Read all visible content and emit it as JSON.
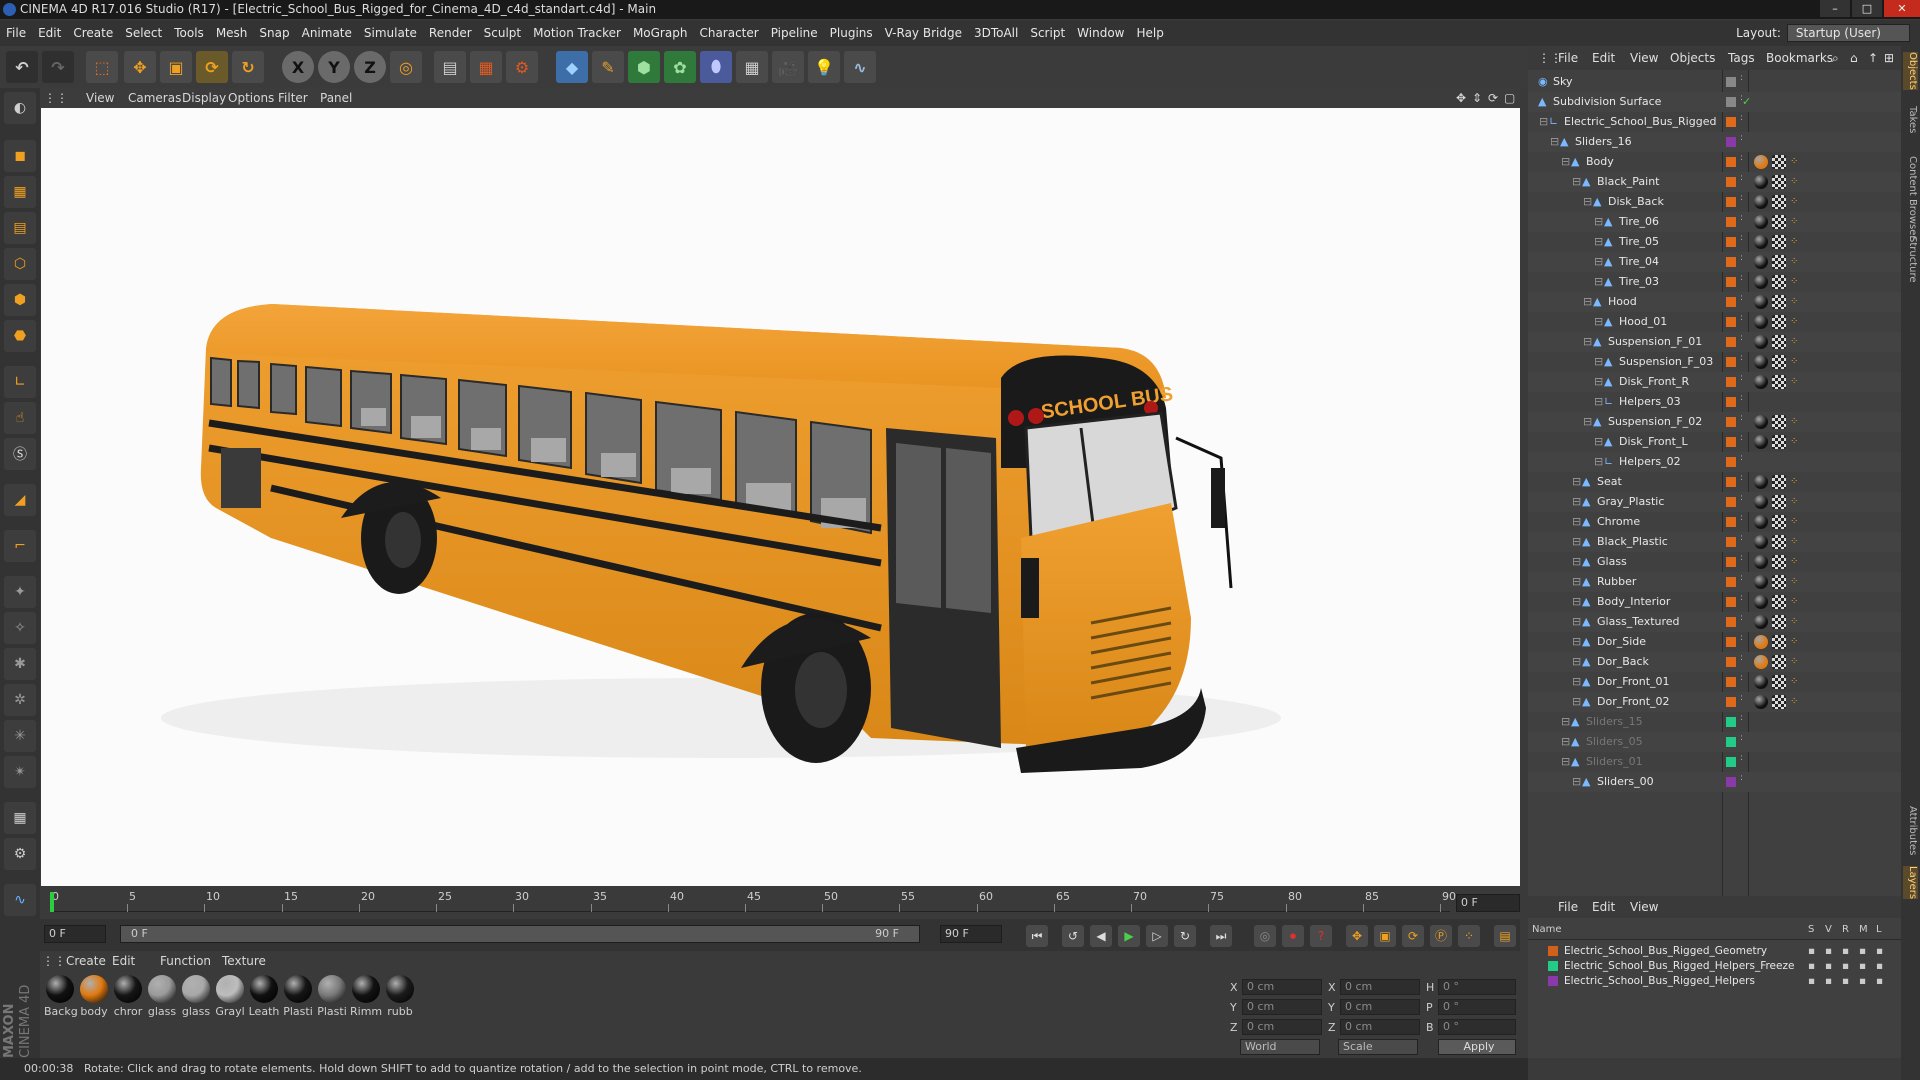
{
  "window": {
    "title": "CINEMA 4D R17.016 Studio (R17) - [Electric_School_Bus_Rigged_for_Cinema_4D_c4d_standart.c4d] - Main"
  },
  "menu": [
    "File",
    "Edit",
    "Create",
    "Select",
    "Tools",
    "Mesh",
    "Snap",
    "Animate",
    "Simulate",
    "Render",
    "Sculpt",
    "Motion Tracker",
    "MoGraph",
    "Character",
    "Pipeline",
    "Plugins",
    "V-Ray Bridge",
    "3DToAll",
    "Script",
    "Window",
    "Help"
  ],
  "layout": {
    "label": "Layout:",
    "value": "Startup (User)"
  },
  "toolbar": {
    "axis_x": "X",
    "axis_y": "Y",
    "axis_z": "Z"
  },
  "viewport_menu": [
    "View",
    "Cameras",
    "Display",
    "Options",
    "Filter",
    "Panel"
  ],
  "bus": {
    "sign": "SCHOOL BUS"
  },
  "timeline": {
    "ticks": [
      "0",
      "5",
      "10",
      "15",
      "20",
      "25",
      "30",
      "35",
      "40",
      "45",
      "50",
      "55",
      "60",
      "65",
      "70",
      "75",
      "80",
      "85",
      "90"
    ],
    "current_frame": "0 F",
    "start_field": "0 F",
    "range_start": "0 F",
    "range_end": "90 F",
    "end_field": "90 F"
  },
  "materials_menu": [
    "Create",
    "Edit",
    "Function",
    "Texture"
  ],
  "materials": [
    {
      "label": "Backg",
      "color": "#111111"
    },
    {
      "label": "body",
      "color": "#e07a10"
    },
    {
      "label": "chror",
      "color": "#151515"
    },
    {
      "label": "glass",
      "color": "#9a9a9a"
    },
    {
      "label": "glass",
      "color": "#a8a8a8"
    },
    {
      "label": "Grayl",
      "color": "#bdbdbd"
    },
    {
      "label": "Leath",
      "color": "#101010"
    },
    {
      "label": "Plasti",
      "color": "#151515"
    },
    {
      "label": "Plasti",
      "color": "#7a7a7a"
    },
    {
      "label": "Rimm",
      "color": "#121212"
    },
    {
      "label": "rubb",
      "color": "#1b1b1b"
    }
  ],
  "coords": {
    "x": "X",
    "y": "Y",
    "z": "Z",
    "pos_x": "0 cm",
    "pos_y": "0 cm",
    "pos_z": "0 cm",
    "size_x": "0 cm",
    "size_y": "0 cm",
    "size_z": "0 cm",
    "h": "H",
    "p": "P",
    "b": "B",
    "rot_h": "0 °",
    "rot_p": "0 °",
    "rot_b": "0 °",
    "world": "World",
    "scale": "Scale",
    "apply": "Apply"
  },
  "status": {
    "time": "00:00:38",
    "message": "Rotate: Click and drag to rotate elements. Hold down SHIFT to add to quantize rotation / add to the selection in point mode, CTRL to remove."
  },
  "objects_menu": [
    "File",
    "Edit",
    "View",
    "Objects",
    "Tags",
    "Bookmarks"
  ],
  "objects": [
    {
      "name": "Sky",
      "depth": 0,
      "color": "#888888"
    },
    {
      "name": "Subdivision Surface",
      "depth": 0,
      "color": "#888888"
    },
    {
      "name": "Electric_School_Bus_Rigged",
      "depth": 1,
      "color": "#e06a1a"
    },
    {
      "name": "Sliders_16",
      "depth": 2,
      "color": "#8a3aa8"
    },
    {
      "name": "Body",
      "depth": 3,
      "color": "#e06a1a"
    },
    {
      "name": "Black_Paint",
      "depth": 4,
      "color": "#e06a1a"
    },
    {
      "name": "Disk_Back",
      "depth": 5,
      "color": "#e06a1a"
    },
    {
      "name": "Tire_06",
      "depth": 6,
      "color": "#e06a1a"
    },
    {
      "name": "Tire_05",
      "depth": 6,
      "color": "#e06a1a"
    },
    {
      "name": "Tire_04",
      "depth": 6,
      "color": "#e06a1a"
    },
    {
      "name": "Tire_03",
      "depth": 6,
      "color": "#e06a1a"
    },
    {
      "name": "Hood",
      "depth": 5,
      "color": "#e06a1a"
    },
    {
      "name": "Hood_01",
      "depth": 6,
      "color": "#e06a1a"
    },
    {
      "name": "Suspension_F_01",
      "depth": 5,
      "color": "#e06a1a"
    },
    {
      "name": "Suspension_F_03",
      "depth": 6,
      "color": "#e06a1a"
    },
    {
      "name": "Disk_Front_R",
      "depth": 6,
      "color": "#e06a1a"
    },
    {
      "name": "Helpers_03",
      "depth": 6,
      "color": "#e06a1a"
    },
    {
      "name": "Suspension_F_02",
      "depth": 5,
      "color": "#e06a1a"
    },
    {
      "name": "Disk_Front_L",
      "depth": 6,
      "color": "#e06a1a"
    },
    {
      "name": "Helpers_02",
      "depth": 6,
      "color": "#e06a1a"
    },
    {
      "name": "Seat",
      "depth": 4,
      "color": "#e06a1a"
    },
    {
      "name": "Gray_Plastic",
      "depth": 4,
      "color": "#e06a1a"
    },
    {
      "name": "Chrome",
      "depth": 4,
      "color": "#e06a1a"
    },
    {
      "name": "Black_Plastic",
      "depth": 4,
      "color": "#e06a1a"
    },
    {
      "name": "Glass",
      "depth": 4,
      "color": "#e06a1a"
    },
    {
      "name": "Rubber",
      "depth": 4,
      "color": "#e06a1a"
    },
    {
      "name": "Body_Interior",
      "depth": 4,
      "color": "#e06a1a"
    },
    {
      "name": "Glass_Textured",
      "depth": 4,
      "color": "#e06a1a"
    },
    {
      "name": "Dor_Side",
      "depth": 4,
      "color": "#e06a1a"
    },
    {
      "name": "Dor_Back",
      "depth": 4,
      "color": "#e06a1a"
    },
    {
      "name": "Dor_Front_01",
      "depth": 4,
      "color": "#e06a1a"
    },
    {
      "name": "Dor_Front_02",
      "depth": 4,
      "color": "#e06a1a"
    },
    {
      "name": "Sliders_15",
      "depth": 3,
      "color": "#22cc88"
    },
    {
      "name": "Sliders_05",
      "depth": 3,
      "color": "#22cc88"
    },
    {
      "name": "Sliders_01",
      "depth": 3,
      "color": "#22cc88"
    },
    {
      "name": "Sliders_00",
      "depth": 4,
      "color": "#8a3aa8"
    }
  ],
  "layers_menu": [
    "File",
    "Edit",
    "View"
  ],
  "layers_header": {
    "name": "Name",
    "s": "S",
    "v": "V",
    "r": "R",
    "m": "M",
    "l": "L"
  },
  "layers": [
    {
      "name": "Electric_School_Bus_Rigged_Geometry",
      "color": "#d0601a"
    },
    {
      "name": "Electric_School_Bus_Rigged_Helpers_Freeze",
      "color": "#22cc88"
    },
    {
      "name": "Electric_School_Bus_Rigged_Helpers",
      "color": "#8a3aa8"
    }
  ],
  "side_tabs": [
    "Objects",
    "Takes",
    "Content Browser",
    "Structure",
    "Attributes",
    "Layers"
  ],
  "maxon": {
    "line1": "MAXON",
    "line2": "CINEMA 4D"
  }
}
